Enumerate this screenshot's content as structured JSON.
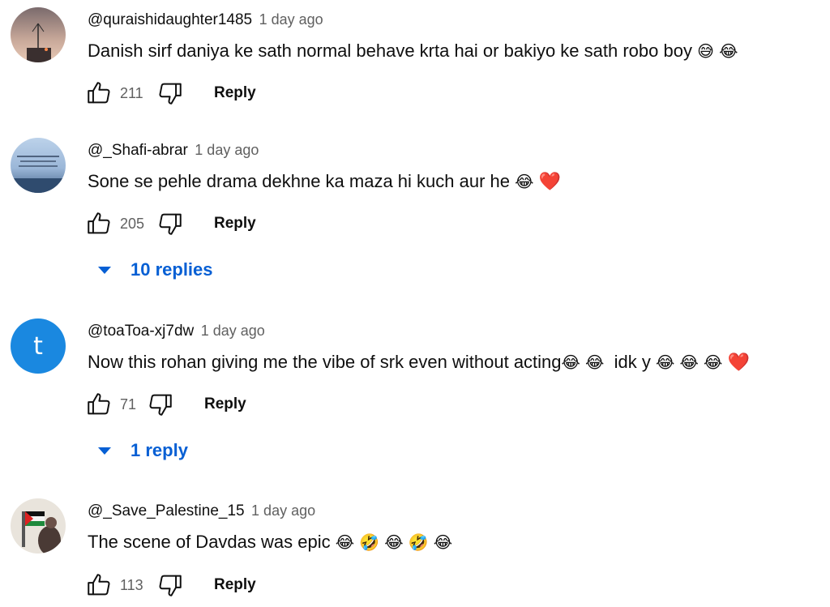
{
  "comments": [
    {
      "author": "@quraishidaughter1485",
      "time": "1 day ago",
      "text": "Danish sirf daniya ke sath normal behave krta hai or bakiyo ke sath robo boy",
      "emojis": [
        "😅",
        "😂"
      ],
      "likes": "211",
      "reply_label": "Reply",
      "replies_label": ""
    },
    {
      "author": "@_Shafi-abrar",
      "time": "1 day ago",
      "text": "Sone se pehle drama dekhne ka maza hi kuch aur he",
      "emojis": [
        "😂",
        "❤️"
      ],
      "likes": "205",
      "reply_label": "Reply",
      "replies_label": "10 replies"
    },
    {
      "author": "@toaToa-xj7dw",
      "time": "1 day ago",
      "avatar_letter": "t",
      "text": "Now this rohan giving me the vibe of srk even without acting",
      "emojis_inline": [
        "😂",
        "😂"
      ],
      "text_after": "idk y",
      "emojis": [
        "😂",
        "😂",
        "😂",
        "❤️"
      ],
      "likes": "71",
      "reply_label": "Reply",
      "replies_label": "1 reply"
    },
    {
      "author": "@_Save_Palestine_15",
      "time": "1 day ago",
      "text": "The scene of Davdas was epic",
      "emojis": [
        "😂",
        "🤣",
        "😂",
        "🤣",
        "😂"
      ],
      "likes": "113",
      "reply_label": "Reply",
      "replies_label": ""
    }
  ],
  "icons": {
    "like": "thumbs-up-icon",
    "dislike": "thumbs-down-icon",
    "expand": "caret-down-icon"
  },
  "colors": {
    "link": "#065fd4",
    "meta": "#606060",
    "avatar_t": "#1a88e0"
  }
}
